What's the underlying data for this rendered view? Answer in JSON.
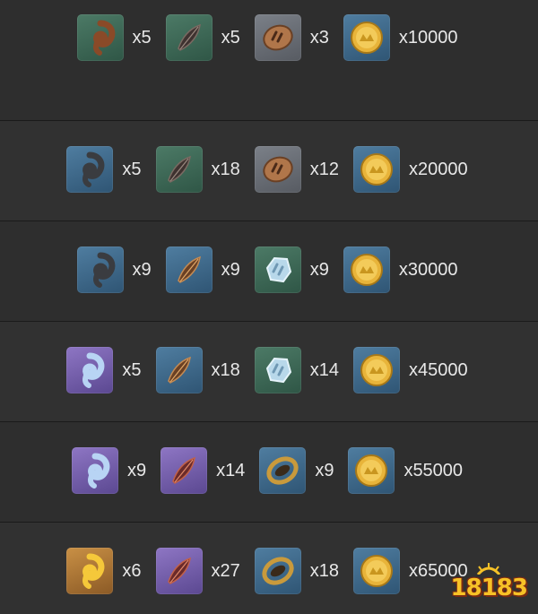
{
  "rows": [
    {
      "items": [
        {
          "icon": "brown-spiral-shell-icon",
          "rarity": "green",
          "qty": "x5"
        },
        {
          "icon": "dark-feather-icon",
          "rarity": "green",
          "qty": "x5"
        },
        {
          "icon": "ornate-disc-icon",
          "rarity": "gray",
          "qty": "x3"
        },
        {
          "icon": "mora-coin-icon",
          "rarity": "blue",
          "qty": "x10000"
        }
      ]
    },
    {
      "items": [
        {
          "icon": "gray-spiral-shell-icon",
          "rarity": "blue",
          "qty": "x5"
        },
        {
          "icon": "dark-feather-icon",
          "rarity": "green",
          "qty": "x18"
        },
        {
          "icon": "ornate-disc-icon",
          "rarity": "gray",
          "qty": "x12"
        },
        {
          "icon": "mora-coin-icon",
          "rarity": "blue",
          "qty": "x20000"
        }
      ]
    },
    {
      "items": [
        {
          "icon": "gray-spiral-shell-icon",
          "rarity": "blue",
          "qty": "x9"
        },
        {
          "icon": "copper-feather-icon",
          "rarity": "blue",
          "qty": "x9"
        },
        {
          "icon": "crystal-disc-icon",
          "rarity": "green",
          "qty": "x9"
        },
        {
          "icon": "mora-coin-icon",
          "rarity": "blue",
          "qty": "x30000"
        }
      ]
    },
    {
      "items": [
        {
          "icon": "blue-spiral-shell-icon",
          "rarity": "purple",
          "qty": "x5"
        },
        {
          "icon": "copper-feather-icon",
          "rarity": "blue",
          "qty": "x18"
        },
        {
          "icon": "crystal-disc-icon",
          "rarity": "green",
          "qty": "x14"
        },
        {
          "icon": "mora-coin-icon",
          "rarity": "blue",
          "qty": "x45000"
        }
      ]
    },
    {
      "items": [
        {
          "icon": "blue-spiral-shell-icon",
          "rarity": "purple",
          "qty": "x9"
        },
        {
          "icon": "crimson-feather-icon",
          "rarity": "purple",
          "qty": "x14"
        },
        {
          "icon": "golden-ring-icon",
          "rarity": "blue",
          "qty": "x9"
        },
        {
          "icon": "mora-coin-icon",
          "rarity": "blue",
          "qty": "x55000"
        }
      ]
    },
    {
      "items": [
        {
          "icon": "golden-spiral-shell-icon",
          "rarity": "gold",
          "qty": "x6"
        },
        {
          "icon": "crimson-feather-icon",
          "rarity": "purple",
          "qty": "x27"
        },
        {
          "icon": "golden-ring-icon",
          "rarity": "blue",
          "qty": "x18"
        },
        {
          "icon": "mora-coin-icon",
          "rarity": "blue",
          "qty": "x65000"
        }
      ]
    }
  ],
  "watermark": {
    "text": "18183"
  },
  "colors": {
    "background": "#2b2b2b",
    "text": "#e8e8e8",
    "rarity_green": "#4c7a66",
    "rarity_blue": "#4f7da0",
    "rarity_purple": "#8e76c4",
    "rarity_gold": "#c99045",
    "coin": "#f0c04a"
  }
}
